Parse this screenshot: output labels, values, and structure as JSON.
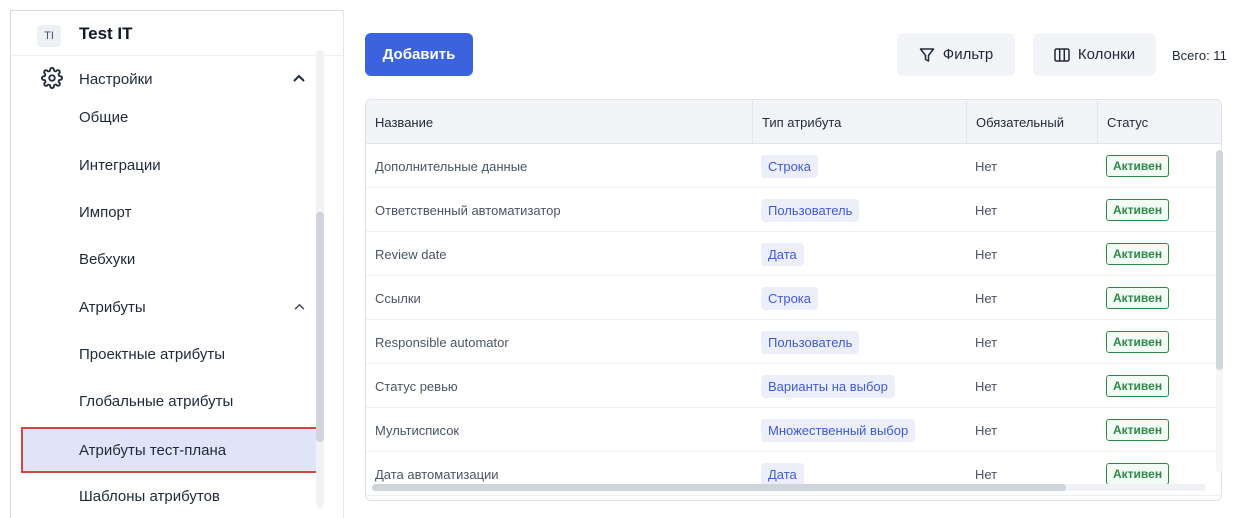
{
  "sidebar": {
    "avatar": "TI",
    "project_title": "Test IT",
    "settings_label": "Настройки",
    "items": [
      {
        "label": "Общие"
      },
      {
        "label": "Интеграции"
      },
      {
        "label": "Импорт"
      },
      {
        "label": "Вебхуки"
      },
      {
        "label": "Атрибуты"
      },
      {
        "label": "Проектные атрибуты"
      },
      {
        "label": "Глобальные атрибуты"
      },
      {
        "label": "Атрибуты тест-плана"
      },
      {
        "label": "Шаблоны атрибутов"
      }
    ],
    "selected_item": "Атрибуты тест-плана"
  },
  "toolbar": {
    "add_label": "Добавить",
    "filter_label": "Фильтр",
    "columns_label": "Колонки",
    "total_label": "Всего: 11"
  },
  "table": {
    "headers": [
      "Название",
      "Тип атрибута",
      "Обязательный",
      "Статус"
    ],
    "rows": [
      {
        "name": "Дополнительные данные",
        "type": "Строка",
        "required": "Нет",
        "status": "Активен"
      },
      {
        "name": "Ответственный автоматизатор",
        "type": "Пользователь",
        "required": "Нет",
        "status": "Активен"
      },
      {
        "name": "Review date",
        "type": "Дата",
        "required": "Нет",
        "status": "Активен"
      },
      {
        "name": "Ссылки",
        "type": "Строка",
        "required": "Нет",
        "status": "Активен"
      },
      {
        "name": "Responsible automator",
        "type": "Пользователь",
        "required": "Нет",
        "status": "Активен"
      },
      {
        "name": "Статус ревью",
        "type": "Варианты на выбор",
        "required": "Нет",
        "status": "Активен"
      },
      {
        "name": "Мультисписок",
        "type": "Множественный выбор",
        "required": "Нет",
        "status": "Активен"
      },
      {
        "name": "Дата автоматизации",
        "type": "Дата",
        "required": "Нет",
        "status": "Активен"
      }
    ]
  },
  "colors": {
    "accent": "#3b63df",
    "status_green": "#2f8a4a",
    "type_badge_text": "#3f5ad8",
    "selected_outline": "#d4453b"
  },
  "icons": [
    "gear-icon",
    "chevron-up-icon",
    "filter-icon",
    "columns-icon"
  ]
}
